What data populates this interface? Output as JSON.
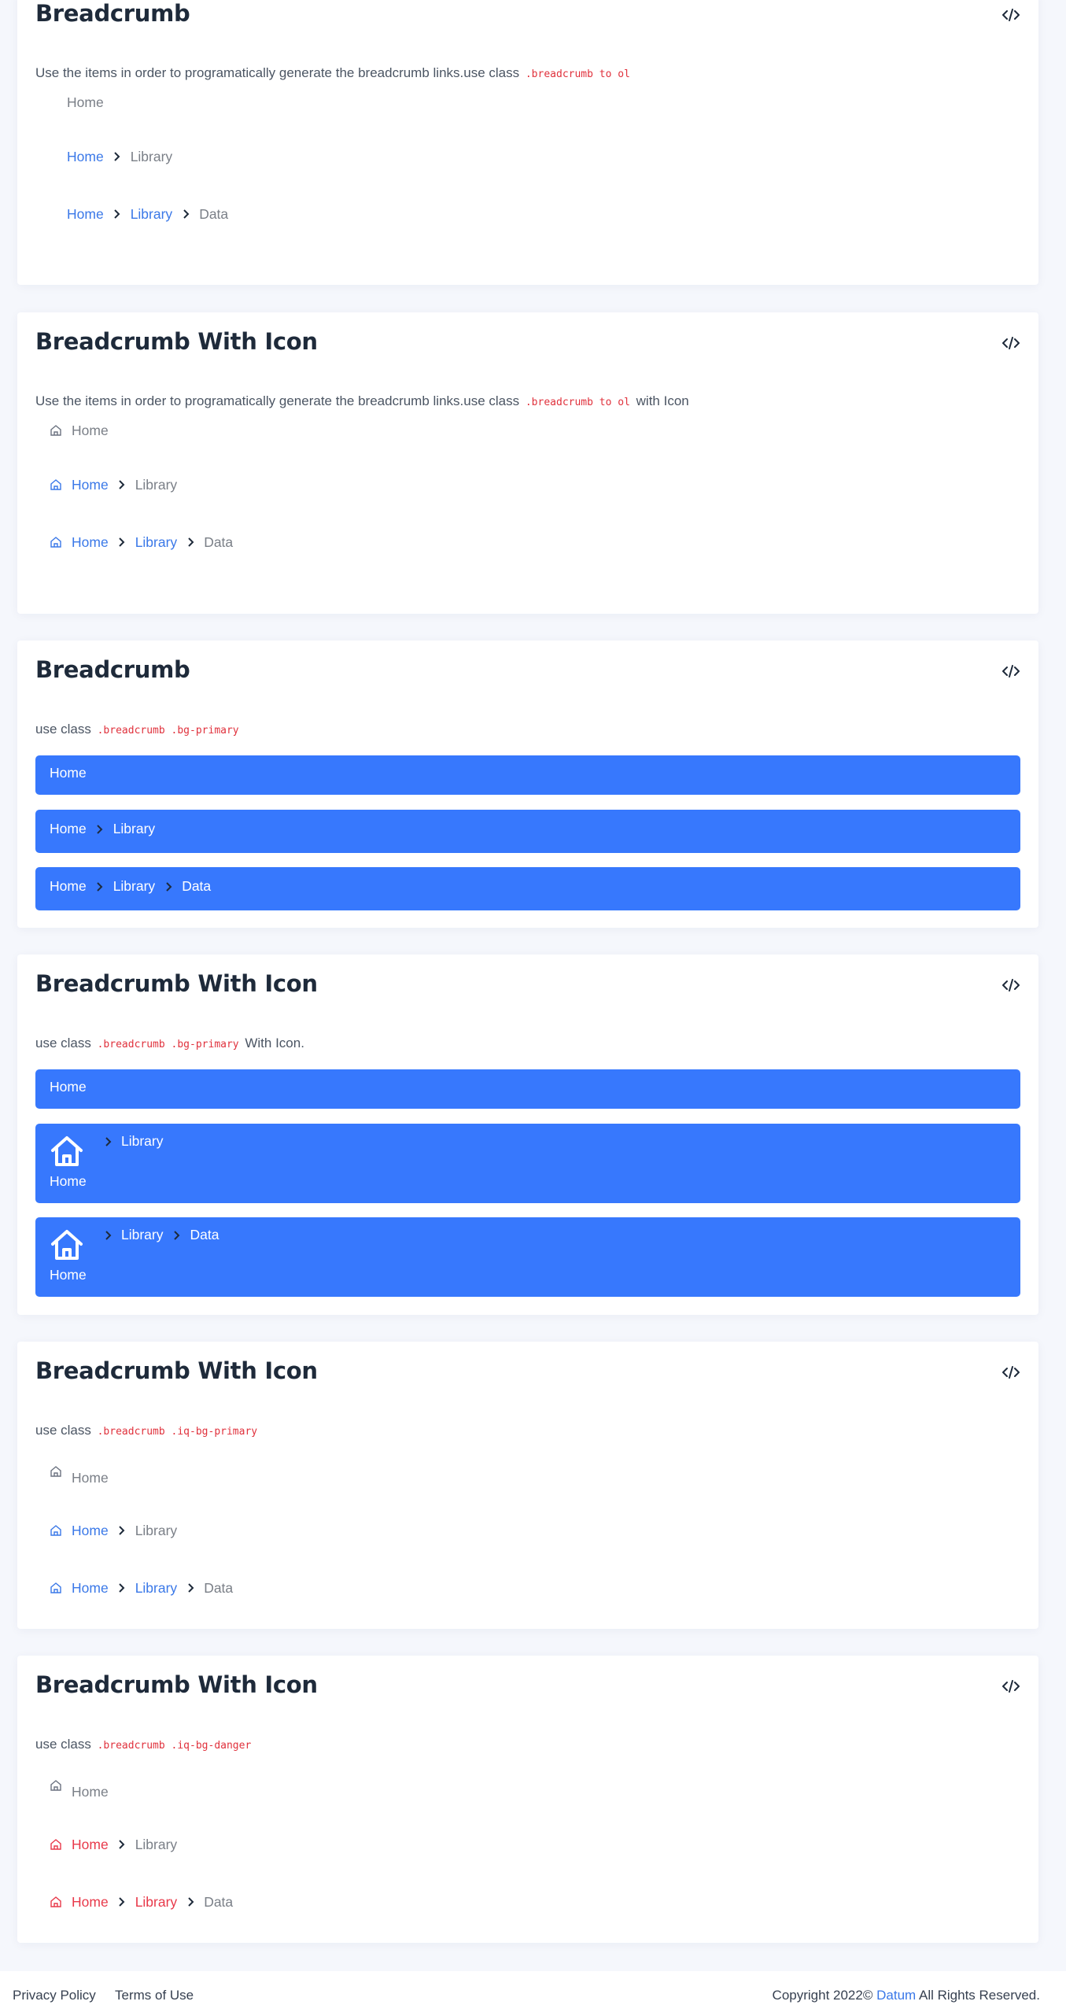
{
  "colors": {
    "primary": "#3778fd",
    "link": "#3a78e8",
    "danger": "#e8394a",
    "code": "#e0313c",
    "title": "#1e2a3a"
  },
  "icons": {
    "code": "code-icon",
    "home": "home-icon",
    "chevron": "chevron-right-icon"
  },
  "cards": [
    {
      "title": "Breadcrumb",
      "desc": "Use the items in order to programatically generate the breadcrumb links.use class",
      "code": ".breadcrumb to ol",
      "desc_suffix": ""
    },
    {
      "title": "Breadcrumb With Icon",
      "desc": "Use the items in order to programatically generate the breadcrumb links.use class",
      "code": ".breadcrumb to ol",
      "desc_suffix": "with Icon"
    },
    {
      "title": "Breadcrumb",
      "desc": "use class",
      "code": ".breadcrumb .bg-primary",
      "desc_suffix": ""
    },
    {
      "title": "Breadcrumb With Icon",
      "desc": "use class",
      "code": ".breadcrumb .bg-primary",
      "desc_suffix": "With Icon."
    },
    {
      "title": "Breadcrumb With Icon",
      "desc": "use class",
      "code": ".breadcrumb .iq-bg-primary",
      "desc_suffix": ""
    },
    {
      "title": "Breadcrumb With Icon",
      "desc": "use class",
      "code": ".breadcrumb .iq-bg-danger",
      "desc_suffix": ""
    }
  ],
  "crumbs": {
    "home": "Home",
    "library": "Library",
    "data": "Data"
  },
  "footer": {
    "privacy": "Privacy Policy",
    "terms": "Terms of Use",
    "copy_prefix": "Copyright 2022©",
    "brand": "Datum",
    "copy_suffix": "All Rights Reserved."
  }
}
